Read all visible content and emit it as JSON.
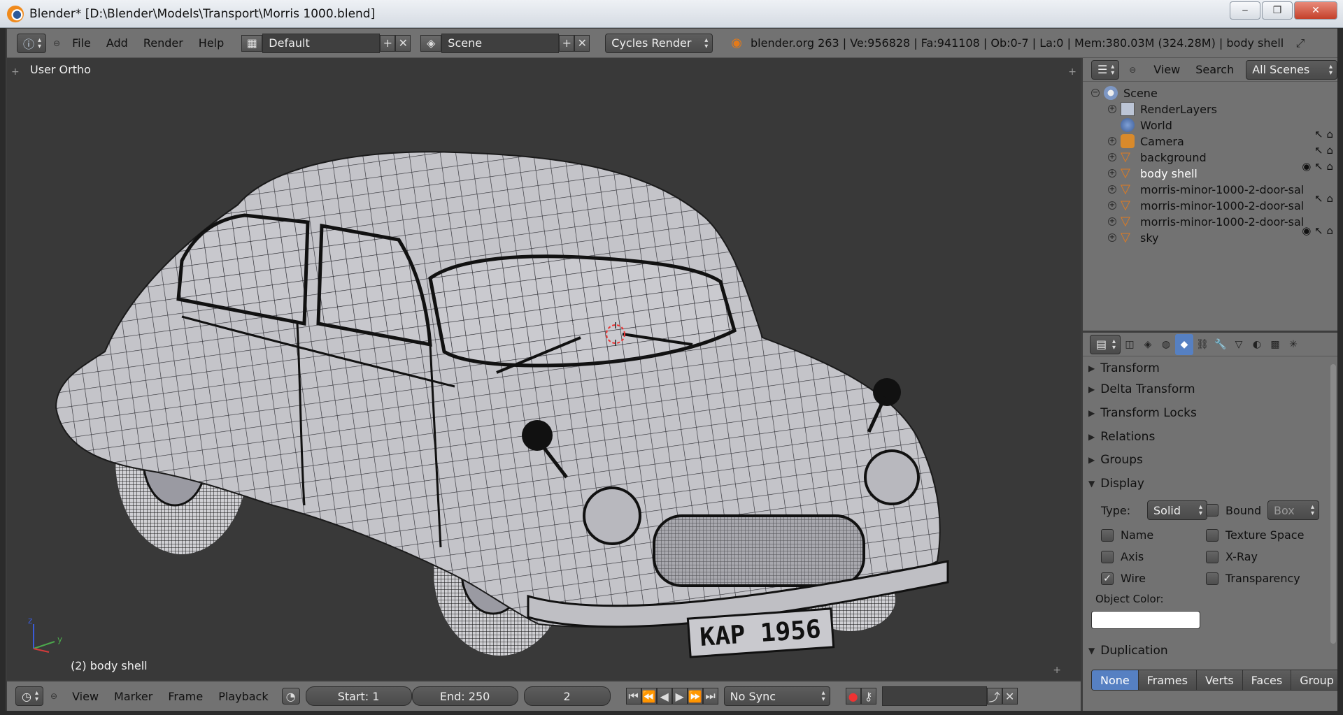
{
  "window": {
    "title": "Blender* [D:\\Blender\\Models\\Transport\\Morris 1000.blend]",
    "minimize": "‒",
    "maximize": "❐",
    "close": "✕"
  },
  "topbar": {
    "menus": [
      "File",
      "Add",
      "Render",
      "Help"
    ],
    "layout": "Default",
    "scene": "Scene",
    "engine": "Cycles Render",
    "info": "blender.org 263 | Ve:956828 | Fa:941108 | Ob:0-7 | La:0 | Mem:380.03M (324.28M) | body shell"
  },
  "viewport": {
    "view_label": "User Ortho",
    "object_label": "(2) body shell",
    "plate": "KAP 1956",
    "axis_y": "y",
    "axis_z": "z"
  },
  "outliner": {
    "menus": [
      "View",
      "Search"
    ],
    "filter": "All Scenes",
    "items": [
      {
        "name": "Scene",
        "icon": "scene-icon"
      },
      {
        "name": "RenderLayers",
        "icon": "renderlayers-icon"
      },
      {
        "name": "World",
        "icon": "world-icon"
      },
      {
        "name": "Camera",
        "icon": "camera-icon"
      },
      {
        "name": "background",
        "icon": "mesh-icon"
      },
      {
        "name": "body shell",
        "icon": "mesh-icon"
      },
      {
        "name": "morris-minor-1000-2-door-sal",
        "icon": "mesh-icon"
      },
      {
        "name": "morris-minor-1000-2-door-sal",
        "icon": "mesh-icon"
      },
      {
        "name": "morris-minor-1000-2-door-sal",
        "icon": "mesh-icon"
      },
      {
        "name": "sky",
        "icon": "mesh-icon"
      }
    ]
  },
  "properties": {
    "panels": [
      "Transform",
      "Delta Transform",
      "Transform Locks",
      "Relations",
      "Groups"
    ],
    "display": {
      "title": "Display",
      "type_label": "Type:",
      "type_value": "Solid",
      "bound_label": "Bound",
      "bound_value": "Box",
      "checks": [
        {
          "label": "Name",
          "checked": false
        },
        {
          "label": "Texture Space",
          "checked": false
        },
        {
          "label": "Axis",
          "checked": false
        },
        {
          "label": "X-Ray",
          "checked": false
        },
        {
          "label": "Wire",
          "checked": true
        },
        {
          "label": "Transparency",
          "checked": false
        }
      ],
      "object_color_label": "Object Color:",
      "object_color": "#ffffff"
    },
    "duplication": {
      "title": "Duplication",
      "options": [
        "None",
        "Frames",
        "Verts",
        "Faces",
        "Group"
      ],
      "selected": "None"
    }
  },
  "timeline": {
    "menus": [
      "View",
      "Marker",
      "Frame",
      "Playback"
    ],
    "start": "Start: 1",
    "end": "End: 250",
    "current": "2",
    "sync": "No Sync"
  },
  "colors": {
    "accent": "#5680c2",
    "header": "#727272",
    "viewport": "#393939",
    "mesh": "#c4c4c9"
  }
}
